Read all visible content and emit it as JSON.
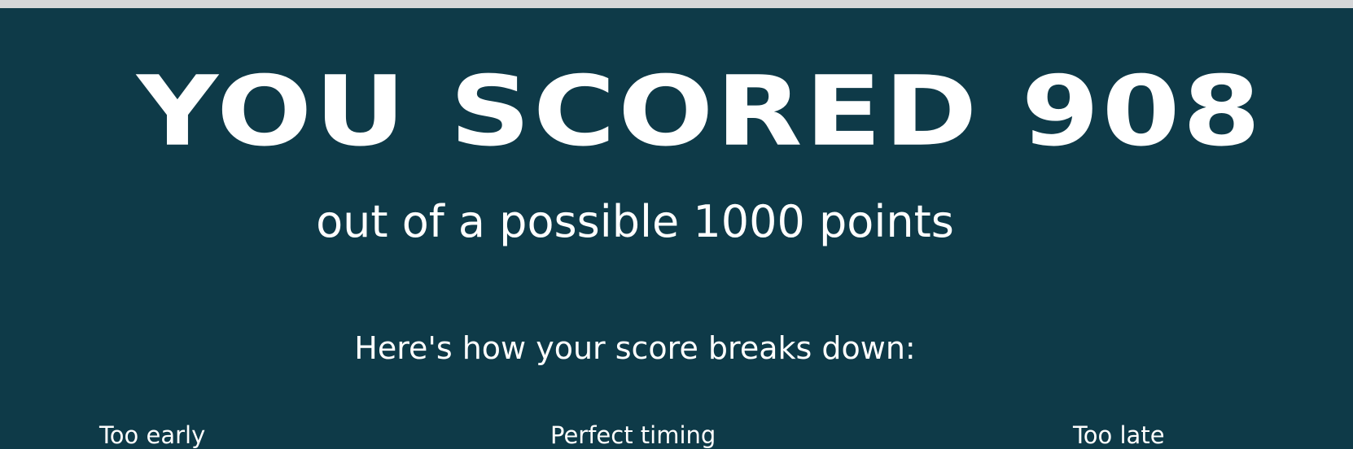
{
  "colors": {
    "panel_background": "#0e3a48",
    "text": "#ffffff",
    "top_border": "#d4d6d8"
  },
  "score_screen": {
    "headline": "YOU SCORED 908",
    "score": 908,
    "max_score": 1000,
    "subtitle": "out of a possible 1000 points",
    "breakdown_heading": "Here's how your score breaks down:",
    "timing_labels": [
      "Too early",
      "Perfect timing",
      "Too late"
    ]
  }
}
